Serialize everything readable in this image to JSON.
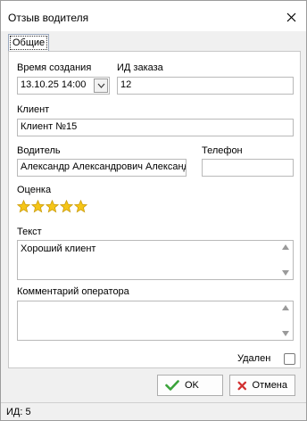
{
  "window": {
    "title": "Отзыв водителя"
  },
  "tabs": [
    {
      "label": "Общие"
    }
  ],
  "form": {
    "created_label": "Время создания",
    "created_value": "13.10.25 14:00",
    "order_label": "ИД заказа",
    "order_value": "12",
    "client_label": "Клиент",
    "client_value": "Клиент №15",
    "driver_label": "Водитель",
    "driver_value": "Александр Александрович Александров",
    "phone_label": "Телефон",
    "phone_value": "",
    "rating_label": "Оценка",
    "rating_value": 5,
    "rating_max": 5,
    "text_label": "Текст",
    "text_value": "Хороший клиент",
    "comment_label": "Комментарий оператора",
    "comment_value": "",
    "deleted_label": "Удален",
    "deleted_checked": false
  },
  "buttons": {
    "ok_label": "OK",
    "cancel_label": "Отмена"
  },
  "status": {
    "text": "ИД: 5"
  },
  "colors": {
    "star": "#f5c518",
    "ok_check": "#3aa33a",
    "cancel_x": "#d23030"
  }
}
